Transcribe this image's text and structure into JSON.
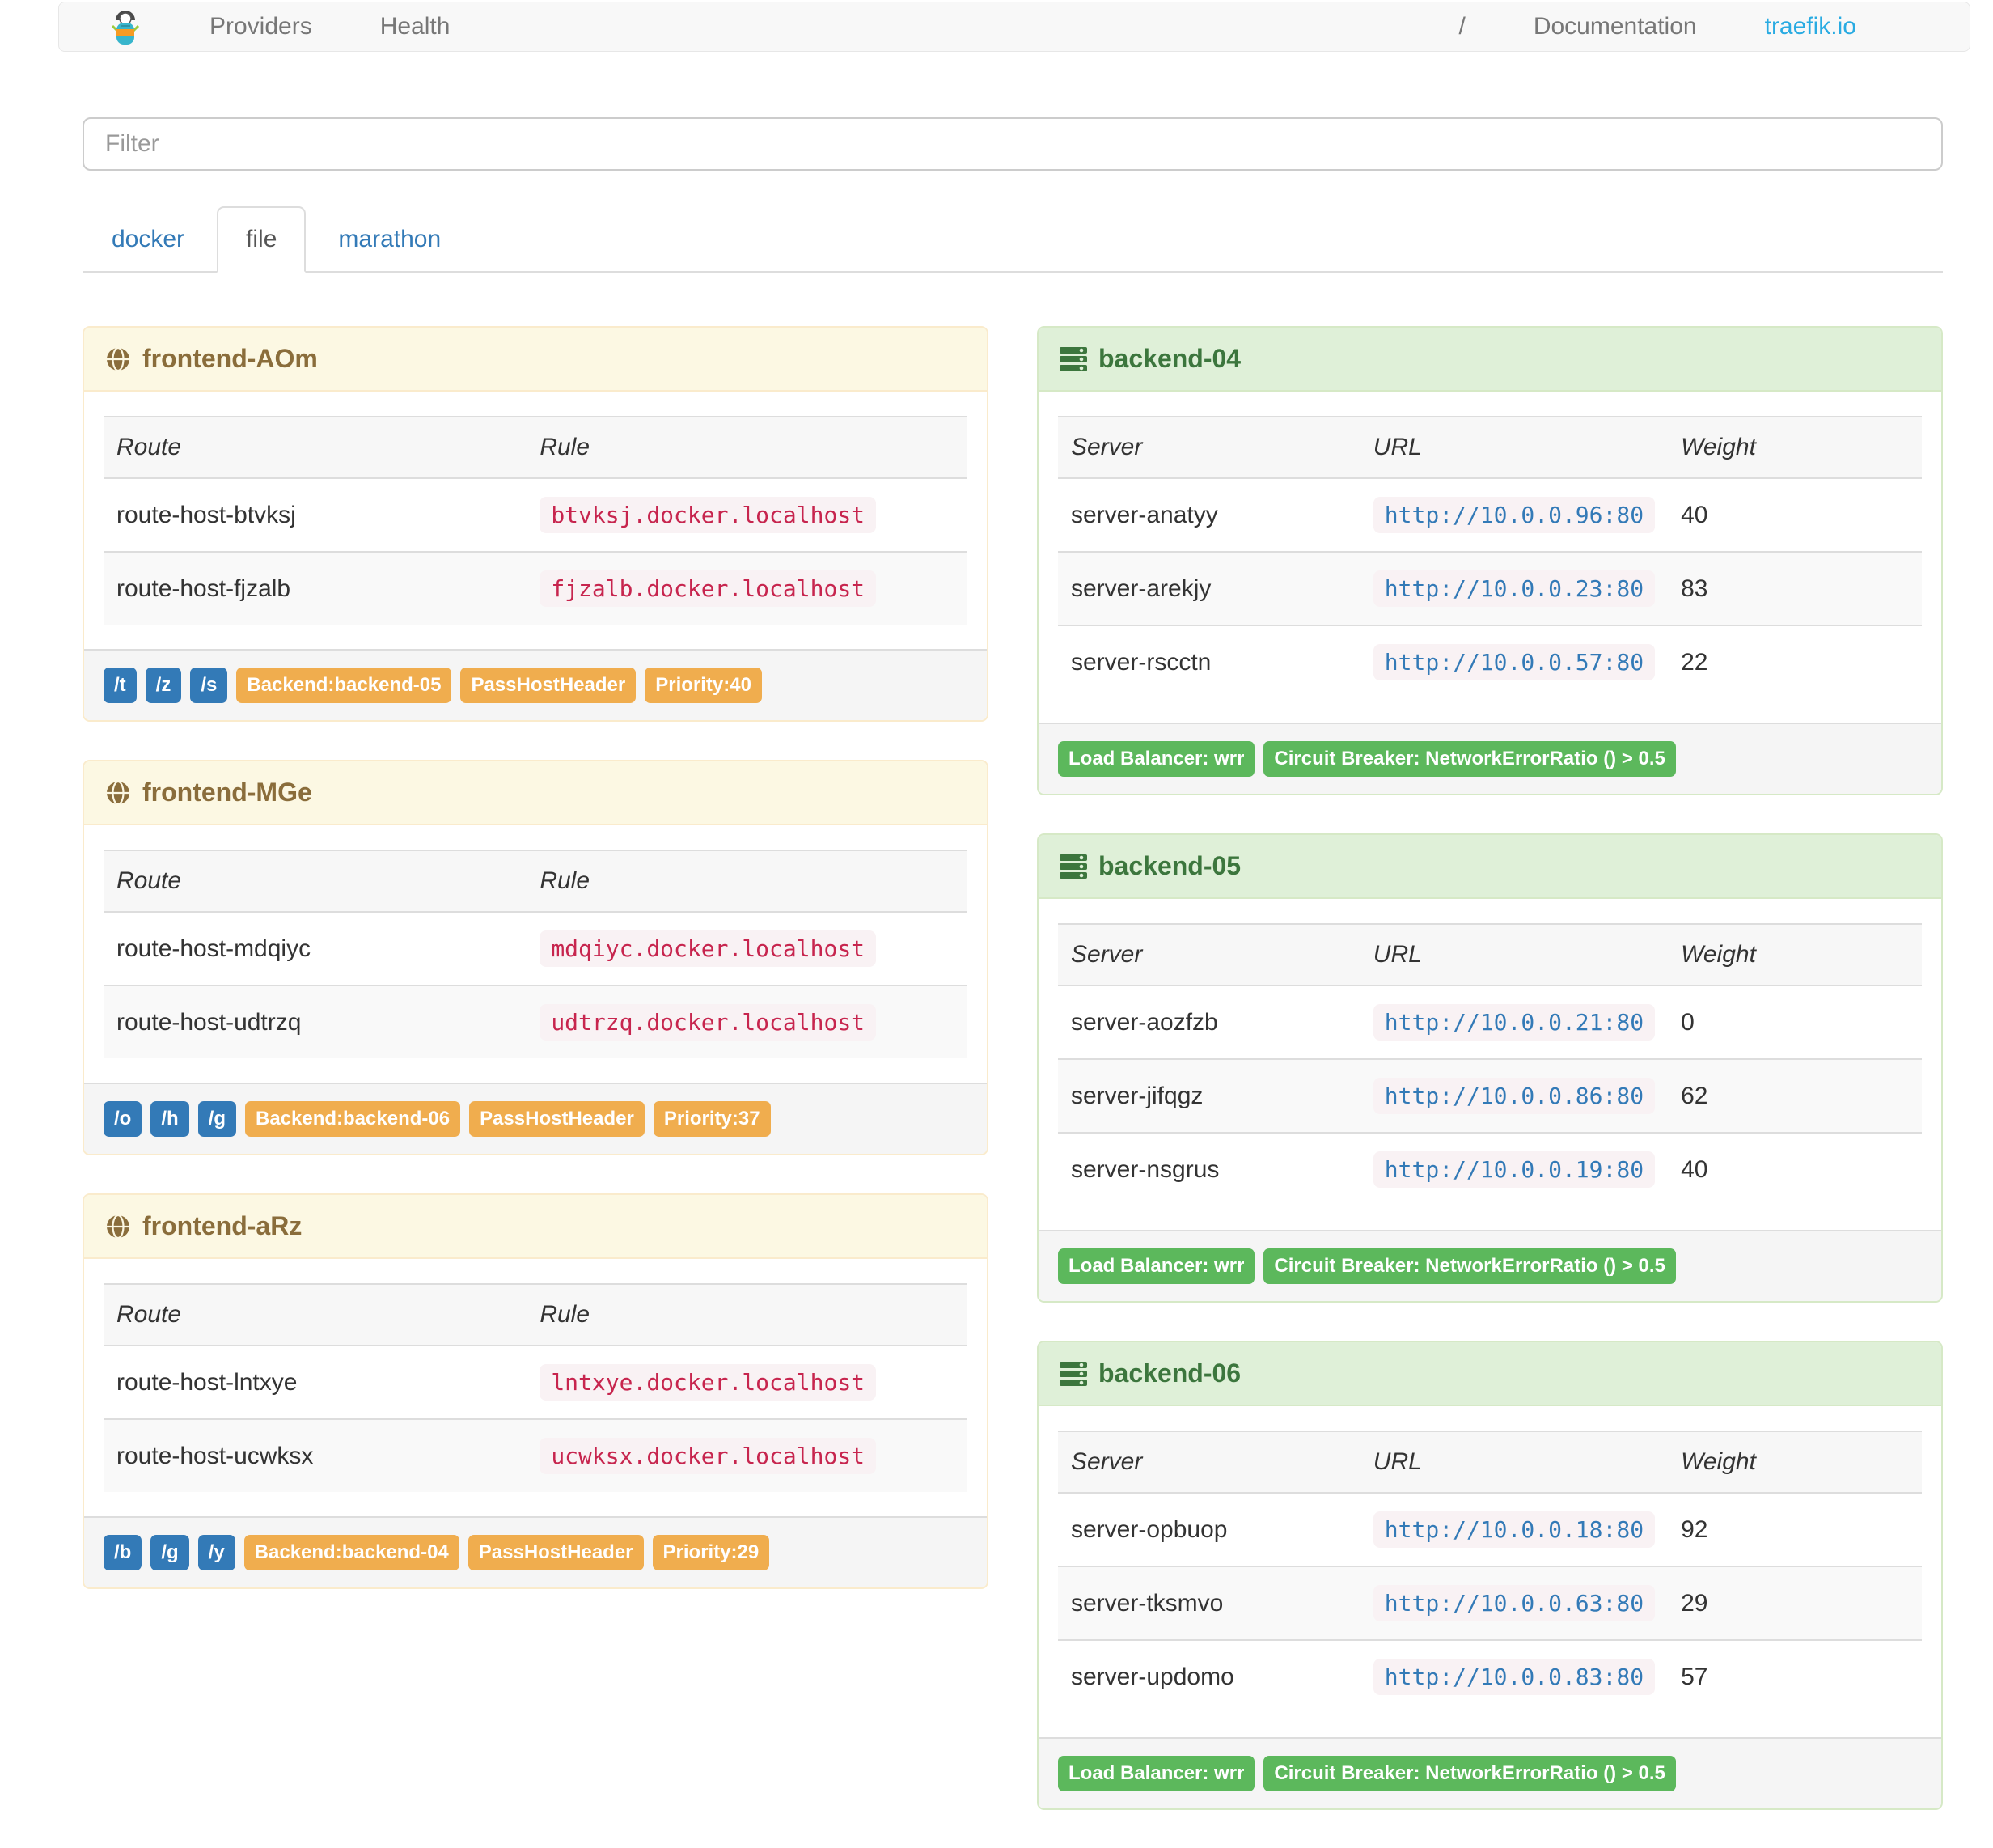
{
  "navbar": {
    "providers_label": "Providers",
    "health_label": "Health",
    "slash_label": "/",
    "documentation_label": "Documentation",
    "site_label": "traefik.io"
  },
  "filter": {
    "placeholder": "Filter"
  },
  "tabs": {
    "docker": "docker",
    "file": "file",
    "marathon": "marathon",
    "active": "file"
  },
  "icons": {
    "brand": "traefik-logo-icon",
    "frontend": "globe-icon",
    "backend": "server-stack-icon"
  },
  "colors": {
    "brand_blue": "#29abe2",
    "label_blue": "#337ab7",
    "label_orange": "#f0ad4e",
    "label_green": "#5cb85c",
    "code_pink": "#c7254e",
    "frontend_header_bg": "#fcf8e3",
    "frontend_header_text": "#8a6d3b",
    "backend_header_bg": "#dff0d8",
    "backend_header_text": "#3c763d"
  },
  "frontends": [
    {
      "title": "frontend-AOm",
      "columns": [
        "Route",
        "Rule"
      ],
      "routes": [
        {
          "route": "route-host-btvksj",
          "rule": "btvksj.docker.localhost"
        },
        {
          "route": "route-host-fjzalb",
          "rule": "fjzalb.docker.localhost"
        }
      ],
      "paths": [
        "/t",
        "/z",
        "/s"
      ],
      "tags": [
        "Backend:backend-05",
        "PassHostHeader",
        "Priority:40"
      ]
    },
    {
      "title": "frontend-MGe",
      "columns": [
        "Route",
        "Rule"
      ],
      "routes": [
        {
          "route": "route-host-mdqiyc",
          "rule": "mdqiyc.docker.localhost"
        },
        {
          "route": "route-host-udtrzq",
          "rule": "udtrzq.docker.localhost"
        }
      ],
      "paths": [
        "/o",
        "/h",
        "/g"
      ],
      "tags": [
        "Backend:backend-06",
        "PassHostHeader",
        "Priority:37"
      ]
    },
    {
      "title": "frontend-aRz",
      "columns": [
        "Route",
        "Rule"
      ],
      "routes": [
        {
          "route": "route-host-lntxye",
          "rule": "lntxye.docker.localhost"
        },
        {
          "route": "route-host-ucwksx",
          "rule": "ucwksx.docker.localhost"
        }
      ],
      "paths": [
        "/b",
        "/g",
        "/y"
      ],
      "tags": [
        "Backend:backend-04",
        "PassHostHeader",
        "Priority:29"
      ]
    }
  ],
  "backends": [
    {
      "title": "backend-04",
      "columns": [
        "Server",
        "URL",
        "Weight"
      ],
      "servers": [
        {
          "server": "server-anatyy",
          "url": "http://10.0.0.96:80",
          "weight": "40"
        },
        {
          "server": "server-arekjy",
          "url": "http://10.0.0.23:80",
          "weight": "83"
        },
        {
          "server": "server-rscctn",
          "url": "http://10.0.0.57:80",
          "weight": "22"
        }
      ],
      "badges": [
        "Load Balancer: wrr",
        "Circuit Breaker: NetworkErrorRatio () > 0.5"
      ]
    },
    {
      "title": "backend-05",
      "columns": [
        "Server",
        "URL",
        "Weight"
      ],
      "servers": [
        {
          "server": "server-aozfzb",
          "url": "http://10.0.0.21:80",
          "weight": "0"
        },
        {
          "server": "server-jifqgz",
          "url": "http://10.0.0.86:80",
          "weight": "62"
        },
        {
          "server": "server-nsgrus",
          "url": "http://10.0.0.19:80",
          "weight": "40"
        }
      ],
      "badges": [
        "Load Balancer: wrr",
        "Circuit Breaker: NetworkErrorRatio () > 0.5"
      ]
    },
    {
      "title": "backend-06",
      "columns": [
        "Server",
        "URL",
        "Weight"
      ],
      "servers": [
        {
          "server": "server-opbuop",
          "url": "http://10.0.0.18:80",
          "weight": "92"
        },
        {
          "server": "server-tksmvo",
          "url": "http://10.0.0.63:80",
          "weight": "29"
        },
        {
          "server": "server-updomo",
          "url": "http://10.0.0.83:80",
          "weight": "57"
        }
      ],
      "badges": [
        "Load Balancer: wrr",
        "Circuit Breaker: NetworkErrorRatio () > 0.5"
      ]
    }
  ]
}
